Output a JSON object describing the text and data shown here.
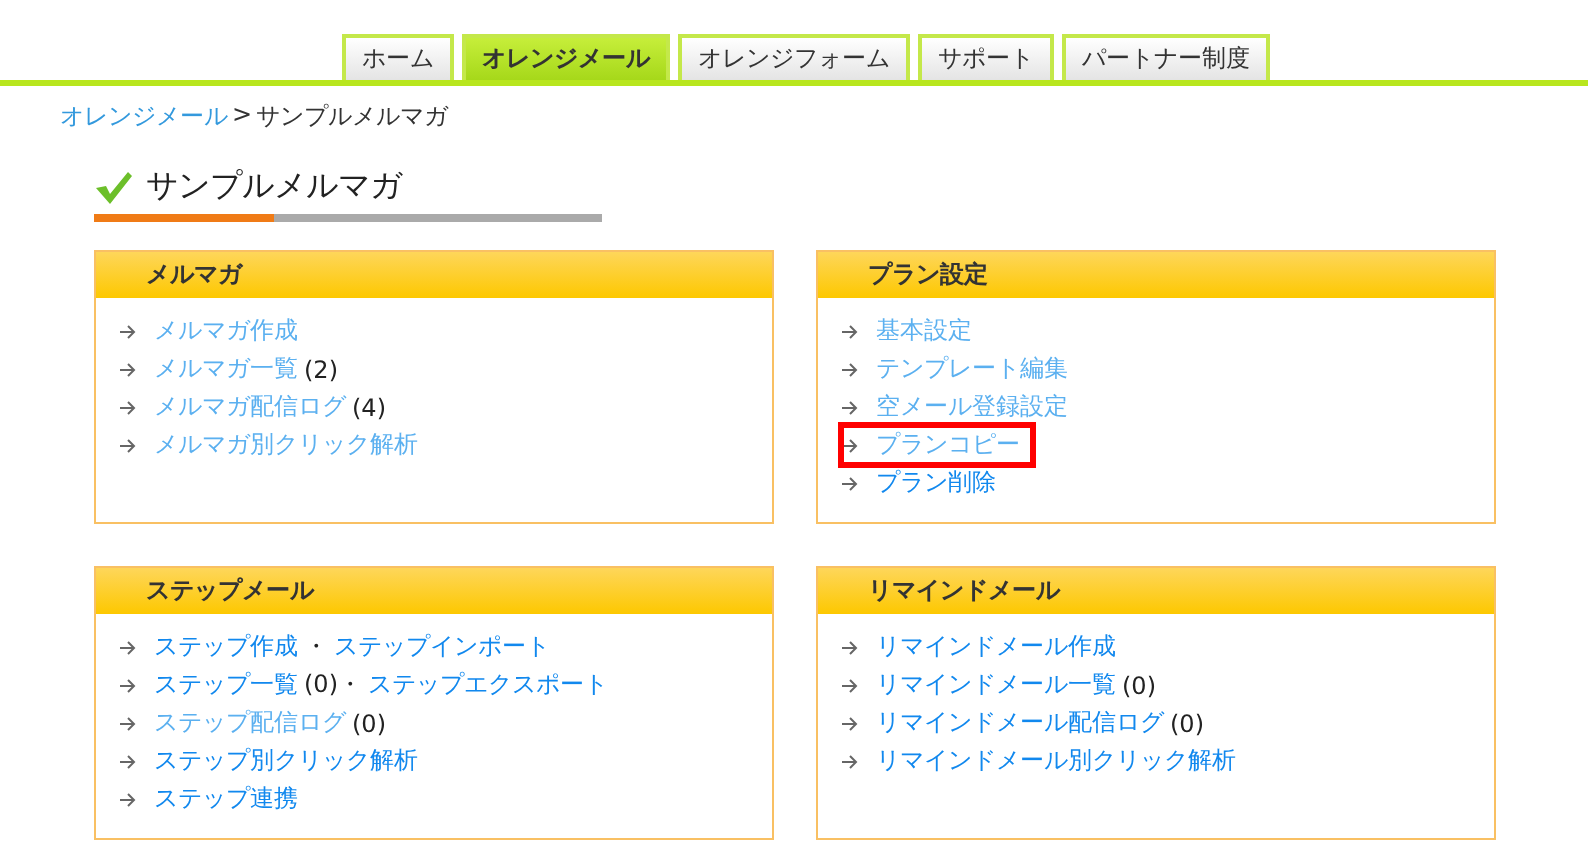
{
  "tabs": [
    {
      "label": "ホーム",
      "selected": false
    },
    {
      "label": "オレンジメール",
      "selected": true
    },
    {
      "label": "オレンジフォーム",
      "selected": false
    },
    {
      "label": "サポート",
      "selected": false
    },
    {
      "label": "パートナー制度",
      "selected": false
    }
  ],
  "breadcrumb": {
    "link": "オレンジメール",
    "separator": ">",
    "current": "サンプルメルマガ"
  },
  "page_title": "サンプルメルマガ",
  "panels": [
    {
      "title": "メルマガ",
      "items": [
        {
          "highlighted": false,
          "parts": [
            {
              "kind": "link",
              "text": "メルマガ作成",
              "visited": true
            }
          ]
        },
        {
          "highlighted": false,
          "parts": [
            {
              "kind": "link",
              "text": "メルマガ一覧",
              "visited": true
            },
            {
              "kind": "text",
              "text": "(2)"
            }
          ]
        },
        {
          "highlighted": false,
          "parts": [
            {
              "kind": "link",
              "text": "メルマガ配信ログ",
              "visited": true
            },
            {
              "kind": "text",
              "text": "(4)"
            }
          ]
        },
        {
          "highlighted": false,
          "parts": [
            {
              "kind": "link",
              "text": "メルマガ別クリック解析",
              "visited": true
            }
          ]
        }
      ]
    },
    {
      "title": "プラン設定",
      "items": [
        {
          "highlighted": false,
          "parts": [
            {
              "kind": "link",
              "text": "基本設定",
              "visited": true
            }
          ]
        },
        {
          "highlighted": false,
          "parts": [
            {
              "kind": "link",
              "text": "テンプレート編集",
              "visited": true
            }
          ]
        },
        {
          "highlighted": false,
          "parts": [
            {
              "kind": "link",
              "text": "空メール登録設定",
              "visited": true
            }
          ]
        },
        {
          "highlighted": true,
          "parts": [
            {
              "kind": "link",
              "text": "プランコピー",
              "visited": true
            }
          ]
        },
        {
          "highlighted": false,
          "parts": [
            {
              "kind": "link",
              "text": "プラン削除",
              "visited": false
            }
          ]
        }
      ]
    },
    {
      "title": "ステップメール",
      "items": [
        {
          "highlighted": false,
          "parts": [
            {
              "kind": "link",
              "text": "ステップ作成",
              "visited": false
            },
            {
              "kind": "text",
              "text": "・"
            },
            {
              "kind": "link",
              "text": "ステップインポート",
              "visited": false
            }
          ]
        },
        {
          "highlighted": false,
          "parts": [
            {
              "kind": "link",
              "text": "ステップ一覧",
              "visited": false
            },
            {
              "kind": "text",
              "text": "(0)・"
            },
            {
              "kind": "link",
              "text": "ステップエクスポート",
              "visited": false
            }
          ]
        },
        {
          "highlighted": false,
          "parts": [
            {
              "kind": "link",
              "text": "ステップ配信ログ",
              "visited": true
            },
            {
              "kind": "text",
              "text": "(0)"
            }
          ]
        },
        {
          "highlighted": false,
          "parts": [
            {
              "kind": "link",
              "text": "ステップ別クリック解析",
              "visited": false
            }
          ]
        },
        {
          "highlighted": false,
          "parts": [
            {
              "kind": "link",
              "text": "ステップ連携",
              "visited": false
            }
          ]
        }
      ]
    },
    {
      "title": "リマインドメール",
      "items": [
        {
          "highlighted": false,
          "parts": [
            {
              "kind": "link",
              "text": "リマインドメール作成",
              "visited": false
            }
          ]
        },
        {
          "highlighted": false,
          "parts": [
            {
              "kind": "link",
              "text": "リマインドメール一覧",
              "visited": false
            },
            {
              "kind": "text",
              "text": "(0)"
            }
          ]
        },
        {
          "highlighted": false,
          "parts": [
            {
              "kind": "link",
              "text": "リマインドメール配信ログ",
              "visited": false
            },
            {
              "kind": "text",
              "text": "(0)"
            }
          ]
        },
        {
          "highlighted": false,
          "parts": [
            {
              "kind": "link",
              "text": "リマインドメール別クリック解析",
              "visited": false
            }
          ]
        }
      ]
    }
  ]
}
